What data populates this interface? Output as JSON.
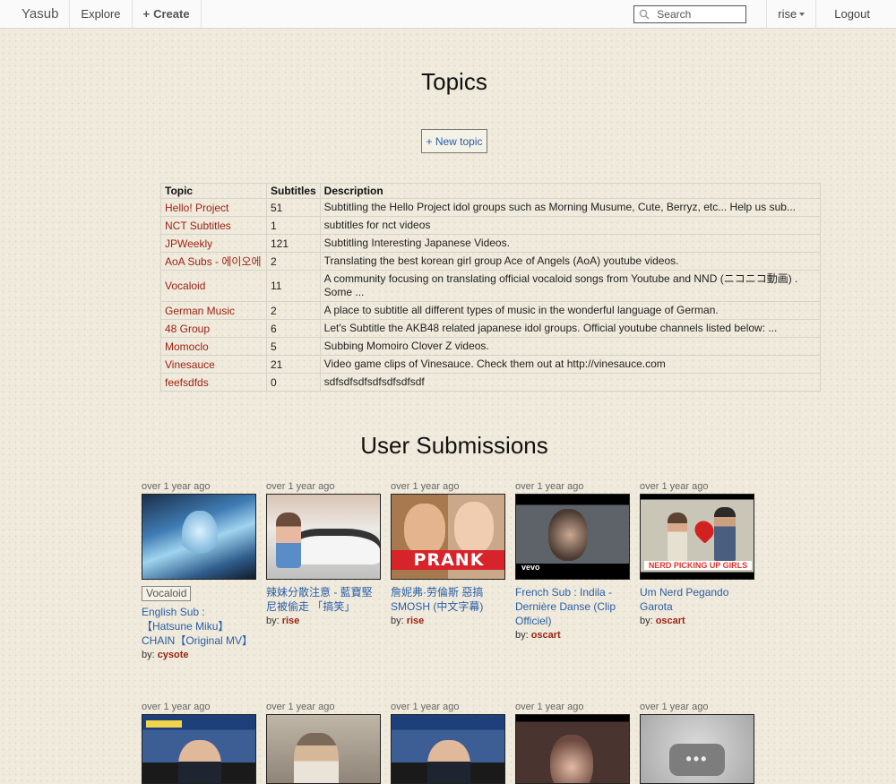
{
  "nav": {
    "brand": "Yasub",
    "explore": "Explore",
    "create_plus": "+",
    "create": "Create",
    "search_placeholder": "Search",
    "user": "rise",
    "logout": "Logout"
  },
  "topics": {
    "heading": "Topics",
    "new_topic": "+ New topic",
    "columns": [
      "Topic",
      "Subtitles",
      "Description"
    ],
    "rows": [
      {
        "topic": "Hello! Project",
        "subtitles": "51",
        "description": "Subtitling the Hello Project idol groups such as Morning Musume, Cute, Berryz, etc... Help us sub..."
      },
      {
        "topic": "NCT Subtitles",
        "subtitles": "1",
        "description": "subtitles for nct videos"
      },
      {
        "topic": "JPWeekly",
        "subtitles": "121",
        "description": "Subtitling Interesting Japanese Videos."
      },
      {
        "topic": "AoA Subs - 에이오에",
        "subtitles": "2",
        "description": "Translating the best korean girl group Ace of Angels (AoA) youtube videos."
      },
      {
        "topic": "Vocaloid",
        "subtitles": "11",
        "description": "A community focusing on translating official vocaloid songs from Youtube and NND (ニコニコ動画) . Some ..."
      },
      {
        "topic": "German Music",
        "subtitles": "2",
        "description": "A place to subtitle all different types of music in the wonderful language of German."
      },
      {
        "topic": "48 Group",
        "subtitles": "6",
        "description": "Let's Subtitle the AKB48 related japanese idol groups. Official youtube channels listed below: ..."
      },
      {
        "topic": "Momoclo",
        "subtitles": "5",
        "description": "Subbing Momoiro Clover Z videos."
      },
      {
        "topic": "Vinesauce",
        "subtitles": "21",
        "description": "Video game clips of Vinesauce. Check them out at http://vinesauce.com"
      },
      {
        "topic": "feefsdfds",
        "subtitles": "0",
        "description": "sdfsdfsdfsdfsdfsdfsdf"
      }
    ]
  },
  "submissions": {
    "heading": "User Submissions",
    "by_label": "by:",
    "items": [
      {
        "time": "over 1 year ago",
        "tag": "Vocaloid",
        "title": "English Sub : 【Hatsune Miku】 CHAIN【Original MV】",
        "author": "cysote"
      },
      {
        "time": "over 1 year ago",
        "title": "辣妹分散注意 - 藍寶堅尼被偷走 「搞笑」",
        "author": "rise"
      },
      {
        "time": "over 1 year ago",
        "title": "詹妮弗·劳倫斯 惡搞 SMOSH (中文字幕)",
        "author": "rise",
        "thumb_text": "PRANK"
      },
      {
        "time": "over 1 year ago",
        "title": "French Sub : Indila - Dernière Danse (Clip Officiel)",
        "author": "oscart",
        "thumb_text": "vevo"
      },
      {
        "time": "over 1 year ago",
        "title": "Um Nerd Pegando Garota",
        "author": "oscart",
        "thumb_text": "NERD PICKING UP GIRLS"
      },
      {
        "time": "over 1 year ago"
      },
      {
        "time": "over 1 year ago"
      },
      {
        "time": "over 1 year ago"
      },
      {
        "time": "over 1 year ago"
      },
      {
        "time": "over 1 year ago",
        "thumb_text": "•••"
      }
    ]
  },
  "colors": {
    "link_red": "#9b2216",
    "link_blue": "#2a5ea8",
    "background": "#efeadb"
  },
  "icons": {
    "search": "search-icon",
    "caret": "caret-down-icon",
    "plus": "plus-icon"
  }
}
